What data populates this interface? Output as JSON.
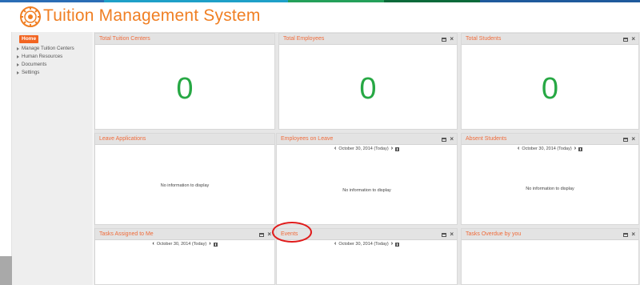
{
  "theme": {
    "accent": "#f07f23",
    "title_color": "#f06b3a",
    "count_color": "#27a844",
    "home_button_color": "#f26522",
    "highlight_color": "#e01b1b",
    "topbar_colors": [
      "#2a6db5",
      "#1ea0c8",
      "#24a05a",
      "#0c6a3a",
      "#1f5a9c"
    ]
  },
  "app": {
    "title": "Tuition Management System",
    "logo_icon": "gear-logo-icon"
  },
  "sidebar": {
    "home_label": "Home",
    "items": [
      {
        "label": "Manage Tuition Centers"
      },
      {
        "label": "Human Resources"
      },
      {
        "label": "Documents"
      },
      {
        "label": "Settings"
      }
    ]
  },
  "widgets": {
    "total_tuition_centers": {
      "title": "Total Tuition Centers",
      "value": "0"
    },
    "total_employees": {
      "title": "Total Employees",
      "value": "0"
    },
    "total_students": {
      "title": "Total Students",
      "value": "0"
    },
    "leave_applications": {
      "title": "Leave Applications",
      "empty": "No information to display"
    },
    "employees_on_leave": {
      "title": "Employees on Leave",
      "date": "October 30, 2014 (Today)",
      "empty": "No information to display"
    },
    "absent_students": {
      "title": "Absent Students",
      "date": "October 30, 2014 (Today)",
      "empty": "No information to display"
    },
    "tasks_assigned": {
      "title": "Tasks Assigned to Me",
      "date": "October 30, 2014 (Today)"
    },
    "events": {
      "title": "Events",
      "date": "October 30, 2014 (Today)"
    },
    "tasks_overdue": {
      "title": "Tasks Overdue by you"
    }
  },
  "controls": {
    "maximize_icon": "maximize-icon",
    "close_icon": "close-icon",
    "close_glyph": "×",
    "prev_glyph": "‹",
    "next_glyph": "›"
  }
}
